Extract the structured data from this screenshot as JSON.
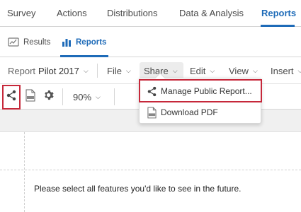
{
  "topnav": {
    "tabs": [
      {
        "label": "Survey"
      },
      {
        "label": "Actions"
      },
      {
        "label": "Distributions"
      },
      {
        "label": "Data & Analysis"
      },
      {
        "label": "Reports",
        "active": true
      }
    ]
  },
  "subnav": {
    "tabs": [
      {
        "label": "Results",
        "icon": "results-icon"
      },
      {
        "label": "Reports",
        "icon": "bar-chart-icon",
        "active": true
      }
    ]
  },
  "menubar": {
    "report_label": "Report",
    "report_name": "Pilot 2017",
    "file": "File",
    "share": "Share",
    "edit": "Edit",
    "view": "View",
    "insert": "Insert"
  },
  "toolbar": {
    "share_icon": "share-icon",
    "pdf_icon": "pdf-icon",
    "settings_icon": "gear-icon",
    "zoom": "90%"
  },
  "share_menu": {
    "items": [
      {
        "label": "Manage Public Report...",
        "icon": "share-icon"
      },
      {
        "label": "Download PDF",
        "icon": "pdf-icon"
      }
    ]
  },
  "content": {
    "question_text": "Please select all features you'd like to see in the future."
  },
  "colors": {
    "accent": "#1e6bb8",
    "highlight": "#c6283a"
  }
}
